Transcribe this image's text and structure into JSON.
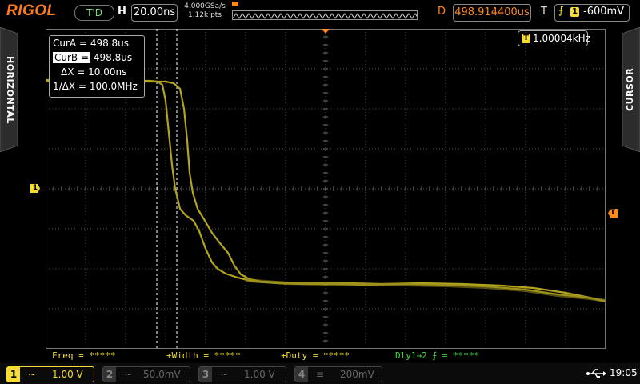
{
  "topbar": {
    "brand": "RIGOL",
    "trigger_status": "T'D",
    "h_label": "H",
    "timebase": "20.00ns",
    "sample_rate": "4.000GSa/s",
    "mem_depth": "1.12k pts",
    "delay_label": "D",
    "delay": "498.914400us",
    "trig_label": "T",
    "trig_source": "1",
    "trig_level": "-600mV"
  },
  "side_tabs": {
    "left": "HORIZONTAL",
    "right": "CURSOR"
  },
  "cursor_panel": {
    "cur_a_label": "CurA =",
    "cur_a_value": "498.8us",
    "cur_b_label": "CurB =",
    "cur_b_value": "498.8us",
    "delta_x_label": "ΔX =",
    "delta_x_value": "10.00ns",
    "inv_delta_x_label": "1/ΔX =",
    "inv_delta_x_value": "100.0MHz"
  },
  "frequency_counter": {
    "badge": "T",
    "value": "1.00004kHz"
  },
  "measurements": [
    {
      "label": "Freq =",
      "value": "*****"
    },
    {
      "label": "+Width =",
      "value": "*****"
    },
    {
      "label": "+Duty =",
      "value": "*****"
    },
    {
      "label": "Dly1→2",
      "value": "*****"
    }
  ],
  "channels": [
    {
      "num": "1",
      "coupling": "~",
      "scale": "1.00 V",
      "active": true,
      "color": "#f5dd32"
    },
    {
      "num": "2",
      "coupling": "~",
      "scale": "50.0mV",
      "active": false,
      "color": "#555555"
    },
    {
      "num": "3",
      "coupling": "~",
      "scale": "1.00 V",
      "active": false,
      "color": "#555555"
    },
    {
      "num": "4",
      "coupling": "≡",
      "scale": "200mV",
      "active": false,
      "color": "#555555"
    }
  ],
  "status": {
    "usb_icon": "usb-icon",
    "time": "19:05"
  },
  "markers": {
    "ch1_marker": "1",
    "trig_level_marker": "T"
  },
  "colors": {
    "trace": "#b2a41c",
    "brand": "#ff7a1a",
    "delay": "#ff8a1a",
    "ch1": "#f5dd32",
    "measure_text": "#f5dd32",
    "delay_meas_text": "#3ddc3d"
  }
}
